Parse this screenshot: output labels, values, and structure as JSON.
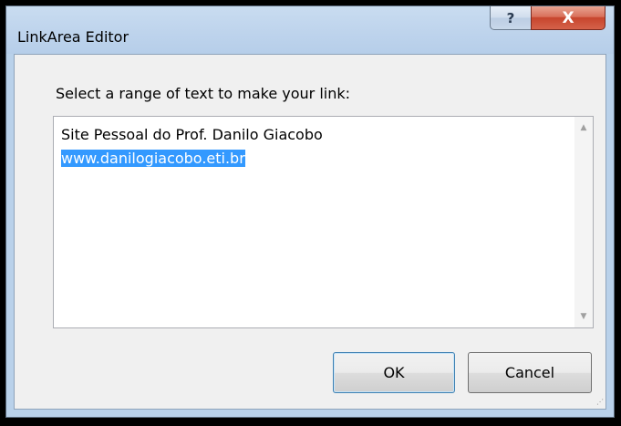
{
  "window": {
    "title": "LinkArea Editor",
    "help_glyph": "?",
    "close_glyph": "X"
  },
  "dialog": {
    "prompt_label": "Select a range of text to make your link:",
    "text_lines": [
      "Site Pessoal do Prof. Danilo Giacobo",
      "www.danilogiacobo.eti.br"
    ],
    "selected_text": "www.danilogiacobo.eti.br",
    "scroll_up_glyph": "▲",
    "scroll_down_glyph": "▼"
  },
  "buttons": {
    "ok_label": "OK",
    "cancel_label": "Cancel"
  },
  "colors": {
    "selection": "#3399ff",
    "close_button": "#c7452d",
    "frame": "#b9d1ea"
  },
  "icons": {
    "help": "help-icon",
    "close": "close-icon",
    "scroll_up": "scroll-up-arrow-icon",
    "scroll_down": "scroll-down-arrow-icon",
    "resize_grip": "resize-grip-icon"
  }
}
